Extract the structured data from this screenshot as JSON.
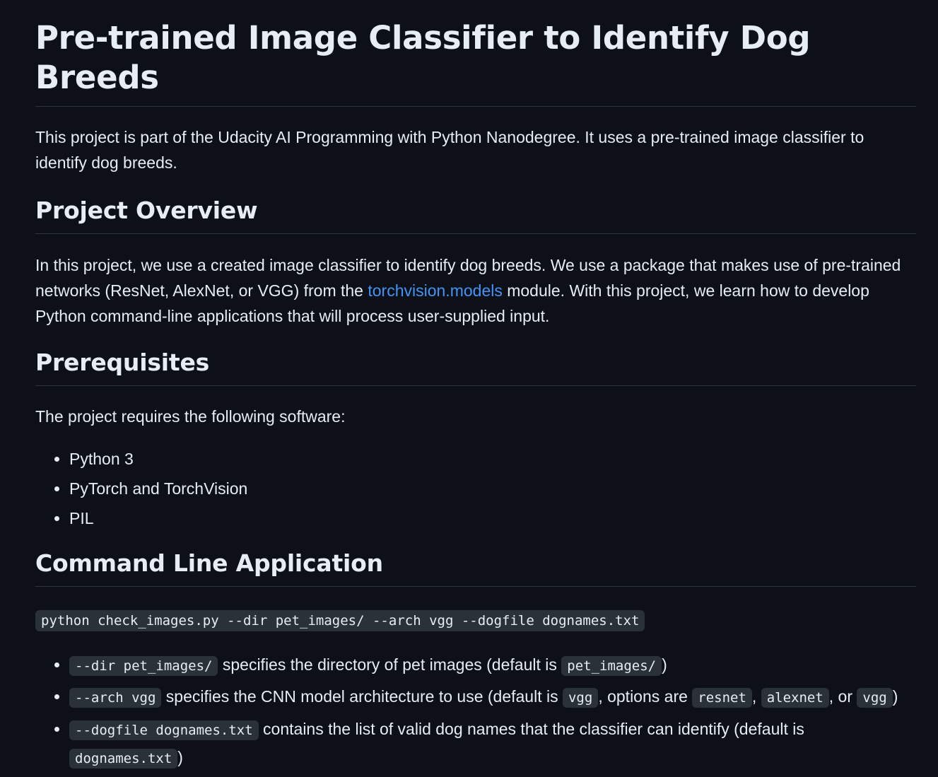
{
  "title": "Pre-trained Image Classifier to Identify Dog Breeds",
  "intro": "This project is part of the Udacity AI Programming with Python Nanodegree. It uses a pre-trained image classifier to identify dog breeds.",
  "overview": {
    "heading": "Project Overview",
    "text_before_link": "In this project, we use a created image classifier to identify dog breeds. We use a package that makes use of pre-trained networks (ResNet, AlexNet, or VGG) from the ",
    "link_text": "torchvision.models",
    "text_after_link": " module. With this project, we learn how to develop Python command-line applications that will process user-supplied input."
  },
  "prerequisites": {
    "heading": "Prerequisites",
    "intro": "The project requires the following software:",
    "items": [
      "Python 3",
      "PyTorch and TorchVision",
      "PIL"
    ]
  },
  "cli": {
    "heading": "Command Line Application",
    "command": "python check_images.py --dir pet_images/ --arch vgg --dogfile dognames.txt",
    "args": [
      {
        "code": "--dir pet_images/",
        "text": " specifies the directory of pet images (default is ",
        "default_code": "pet_images/",
        "close": ")"
      },
      {
        "code": "--arch vgg",
        "text": " specifies the CNN model architecture to use (default is ",
        "default_code": "vgg",
        "options_text": ", options are ",
        "option1": "resnet",
        "sep1": ", ",
        "option2": "alexnet",
        "sep2": ", or ",
        "option3": "vgg",
        "close": ")"
      },
      {
        "code": "--dogfile dognames.txt",
        "text": " contains the list of valid dog names that the classifier can identify (default is ",
        "default_code": "dognames.txt",
        "close": ")"
      }
    ]
  },
  "colors": {
    "background": "#0d1117",
    "text": "#e6edf3",
    "link": "#4493f8",
    "code_background": "#2b3139",
    "divider": "#30363d"
  }
}
